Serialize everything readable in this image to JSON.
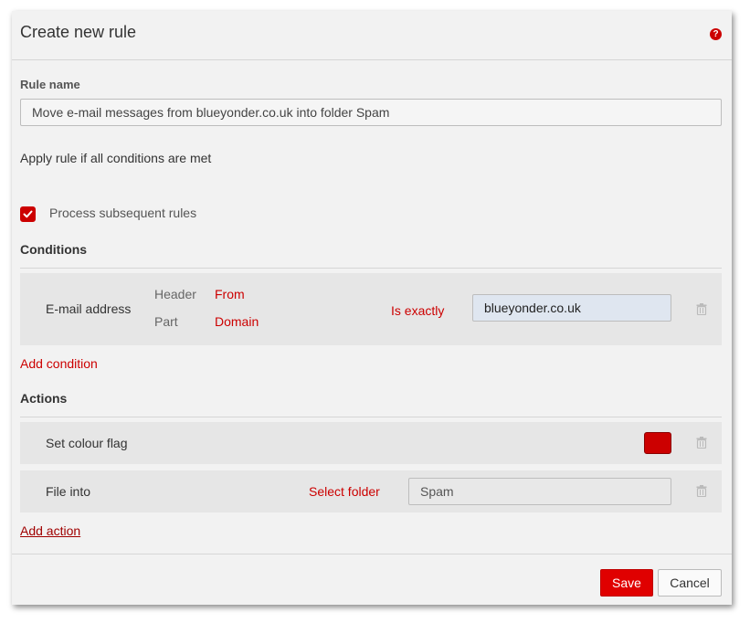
{
  "dialog": {
    "title": "Create new rule",
    "help_icon": "question-mark-icon"
  },
  "rule_name": {
    "label": "Rule name",
    "value": "Move e-mail messages from blueyonder.co.uk into folder Spam"
  },
  "apply_text": "Apply rule if all conditions are met",
  "process_subsequent": {
    "label": "Process subsequent rules",
    "checked": true
  },
  "conditions": {
    "title": "Conditions",
    "items": [
      {
        "type": "E-mail address",
        "header_label": "Header",
        "header_value": "From",
        "part_label": "Part",
        "part_value": "Domain",
        "comparison": "Is exactly",
        "value": "blueyonder.co.uk"
      }
    ],
    "add_label": "Add condition"
  },
  "actions": {
    "title": "Actions",
    "items": [
      {
        "type": "Set colour flag",
        "flag_color": "#cc0000"
      },
      {
        "type": "File into",
        "select_label": "Select folder",
        "folder": "Spam"
      }
    ],
    "add_label": "Add action"
  },
  "footer": {
    "save_label": "Save",
    "cancel_label": "Cancel"
  },
  "colors": {
    "accent": "#cc0000",
    "save_button": "#e00000",
    "dialog_bg": "#f2f2f2",
    "row_bg": "#e6e6e6"
  }
}
